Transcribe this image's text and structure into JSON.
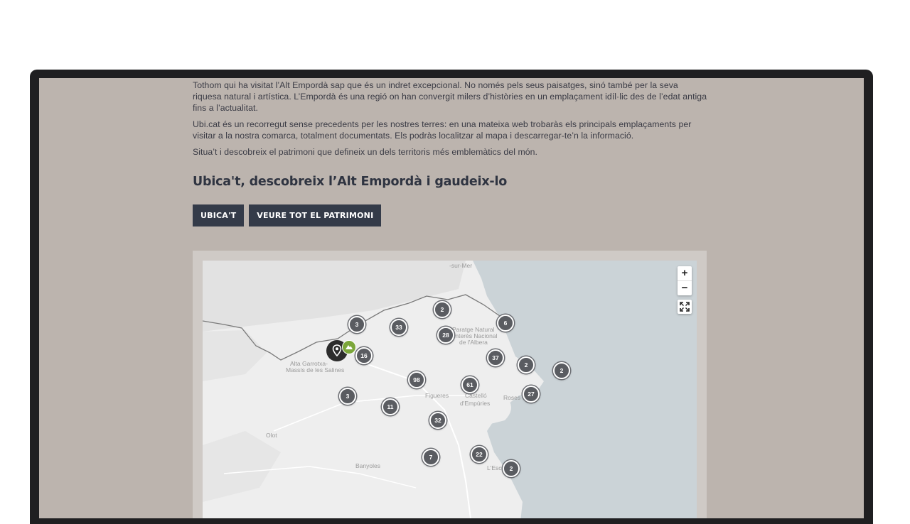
{
  "intro": {
    "paragraphs": [
      "Tothom qui ha visitat l’Alt Empordà sap que és un indret excepcional. No només pels seus paisatges, sinó també per la seva riquesa natural i artística. L’Empordà és una regió on han convergit milers d’històries en un emplaçament idíl·lic des de l’edat antiga fins a l’actualitat.",
      "Ubi.cat és un recorregut sense precedents per les nostres terres: en una mateixa web trobaràs els principals emplaçaments per visitar a la nostra comarca, totalment documentats. Els podràs localitzar al mapa i descarregar-te’n la informació.",
      "Situa’t i descobreix el patrimoni que defineix un dels territoris més emblemàtics del món."
    ],
    "heading": "Ubica't, descobreix l’Alt Empordà i gaudeix-lo"
  },
  "buttons": {
    "locate": "UBICA'T",
    "heritage": "VEURE TOT EL PATRIMONI"
  },
  "map": {
    "zoom_in": "+",
    "zoom_out": "−",
    "fullscreen_icon": "fullscreen-icon",
    "locate_icon": "location-pin-icon",
    "colors": {
      "sea": "#cbd3d7",
      "land": "#eeeeee",
      "cluster": "#5a5c61",
      "accent": "#7ba63a"
    },
    "place_labels": {
      "sur_mer": "-sur-Mer",
      "paratge_1": "Paratge Natural",
      "paratge_2": "Interès Nacional",
      "paratge_3": "de l'Albera",
      "garrotxa_1": "Alta Garrotxa-",
      "garrotxa_2": "Massís de les Salines",
      "figueres": "Figueres",
      "castello_1": "Castelló",
      "castello_2": "d'Empúries",
      "roses": "Roses",
      "olot": "Olot",
      "banyoles": "Banyoles",
      "lescala": "L'Escala"
    },
    "clusters": [
      "2",
      "6",
      "3",
      "33",
      "28",
      "16",
      "37",
      "2",
      "2",
      "98",
      "61",
      "27",
      "3",
      "11",
      "32",
      "7",
      "22",
      "2"
    ]
  }
}
